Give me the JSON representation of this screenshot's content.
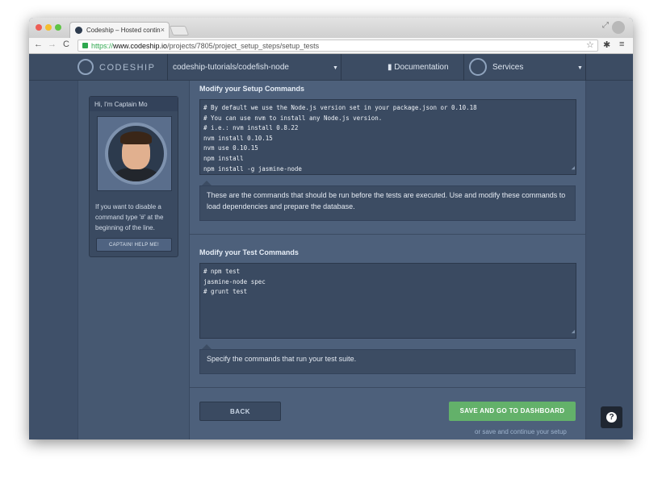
{
  "browser": {
    "tab_title": "Codeship – Hosted contin",
    "tab_close": "×",
    "url_scheme": "https://",
    "url_host": "www.codeship.io",
    "url_path": "/projects/7805/project_setup_steps/setup_tests",
    "nav_back": "←",
    "nav_forward": "→",
    "nav_reload": "C",
    "star_glyph": "☆",
    "settings_glyph": "✱",
    "menu_glyph": "≡",
    "fullscreen_glyph": "⤢"
  },
  "header": {
    "logo_text": "CODESHIP",
    "project": "codeship-tutorials/codefish-node",
    "documentation": "Documentation",
    "doc_glyph": "▮",
    "services": "Services",
    "caret": "▼"
  },
  "captain": {
    "title": "Hi, I'm Captain Mo",
    "message": "If you want to disable a command type '#' at the beginning of the line.",
    "help_button": "CAPTAIN! HELP ME!"
  },
  "setup": {
    "title": "Modify your Setup Commands",
    "lines": [
      "# By default we use the Node.js version set in your package.json or 0.10.18",
      "# You can use nvm to install any Node.js version.",
      "# i.e.: nvm install 0.8.22",
      "nvm install 0.10.15",
      "nvm use 0.10.15",
      "npm install",
      "npm install -g jasmine-node"
    ],
    "hint": "These are the commands that should be run before the tests are executed. Use and modify these commands to load dependencies and prepare the database."
  },
  "tests": {
    "title": "Modify your Test Commands",
    "lines": [
      "# npm test",
      "jasmine-node spec",
      "# grunt test"
    ],
    "hint": "Specify the commands that run your test suite."
  },
  "actions": {
    "back": "BACK",
    "save": "SAVE AND GO TO DASHBOARD",
    "save_link": "or save and continue your setup",
    "help_glyph": "?"
  },
  "colors": {
    "primary": "#63b16a",
    "background": "#4d607b",
    "panel": "#3a4a61"
  }
}
